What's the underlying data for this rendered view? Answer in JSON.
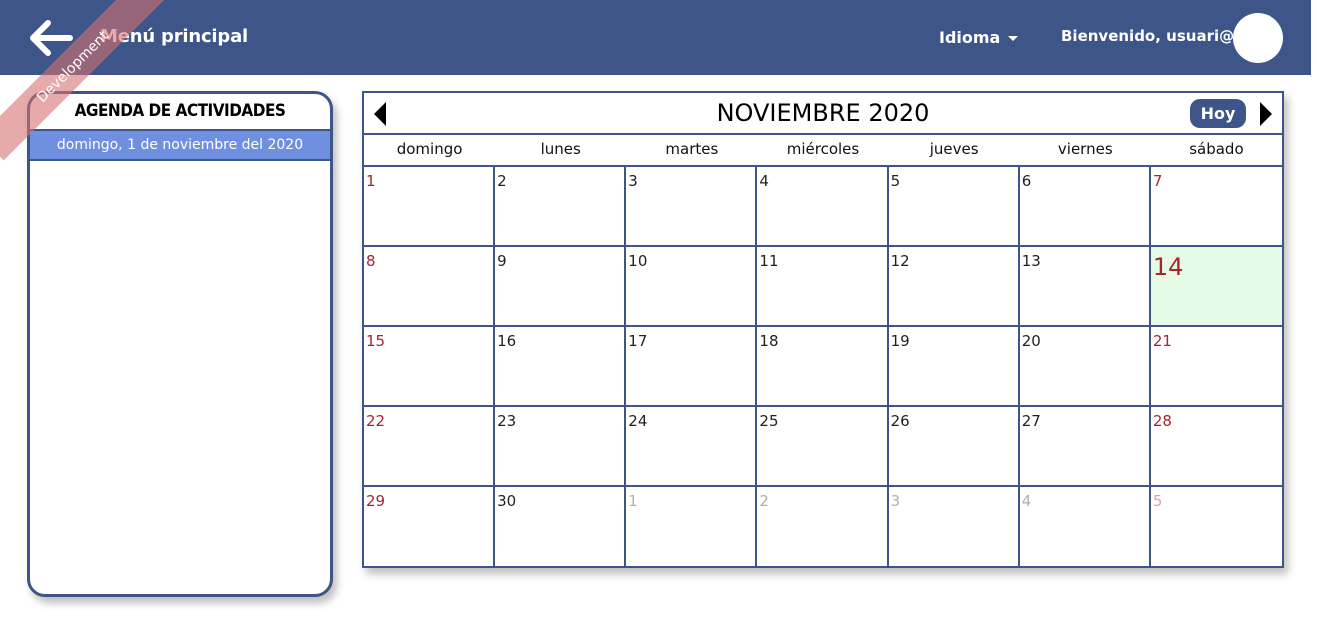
{
  "header": {
    "title": "Menú principal",
    "language_label": "Idioma",
    "welcome_text": "Bienvenido, usuari@"
  },
  "ribbon": {
    "label": "Development"
  },
  "agenda": {
    "title": "AGENDA DE ACTIVIDADES",
    "selected_date": "domingo, 1 de noviembre del 2020"
  },
  "calendar": {
    "month_title": "NOVIEMBRE 2020",
    "today_label": "Hoy",
    "weekdays": [
      "domingo",
      "lunes",
      "martes",
      "miércoles",
      "jueves",
      "viernes",
      "sábado"
    ],
    "days": [
      {
        "n": "1",
        "other": false
      },
      {
        "n": "2",
        "other": false
      },
      {
        "n": "3",
        "other": false
      },
      {
        "n": "4",
        "other": false
      },
      {
        "n": "5",
        "other": false
      },
      {
        "n": "6",
        "other": false
      },
      {
        "n": "7",
        "other": false
      },
      {
        "n": "8",
        "other": false
      },
      {
        "n": "9",
        "other": false
      },
      {
        "n": "10",
        "other": false
      },
      {
        "n": "11",
        "other": false
      },
      {
        "n": "12",
        "other": false
      },
      {
        "n": "13",
        "other": false
      },
      {
        "n": "14",
        "other": false,
        "today": true
      },
      {
        "n": "15",
        "other": false
      },
      {
        "n": "16",
        "other": false
      },
      {
        "n": "17",
        "other": false
      },
      {
        "n": "18",
        "other": false
      },
      {
        "n": "19",
        "other": false
      },
      {
        "n": "20",
        "other": false
      },
      {
        "n": "21",
        "other": false
      },
      {
        "n": "22",
        "other": false
      },
      {
        "n": "23",
        "other": false
      },
      {
        "n": "24",
        "other": false
      },
      {
        "n": "25",
        "other": false
      },
      {
        "n": "26",
        "other": false
      },
      {
        "n": "27",
        "other": false
      },
      {
        "n": "28",
        "other": false
      },
      {
        "n": "29",
        "other": false
      },
      {
        "n": "30",
        "other": false
      },
      {
        "n": "1",
        "other": true
      },
      {
        "n": "2",
        "other": true
      },
      {
        "n": "3",
        "other": true
      },
      {
        "n": "4",
        "other": true
      },
      {
        "n": "5",
        "other": true
      }
    ]
  },
  "colors": {
    "primary": "#3e5589",
    "selected_date_bg": "#6f8fe0",
    "weekend_text": "#a3262f",
    "today_bg": "#e6fbe6"
  }
}
